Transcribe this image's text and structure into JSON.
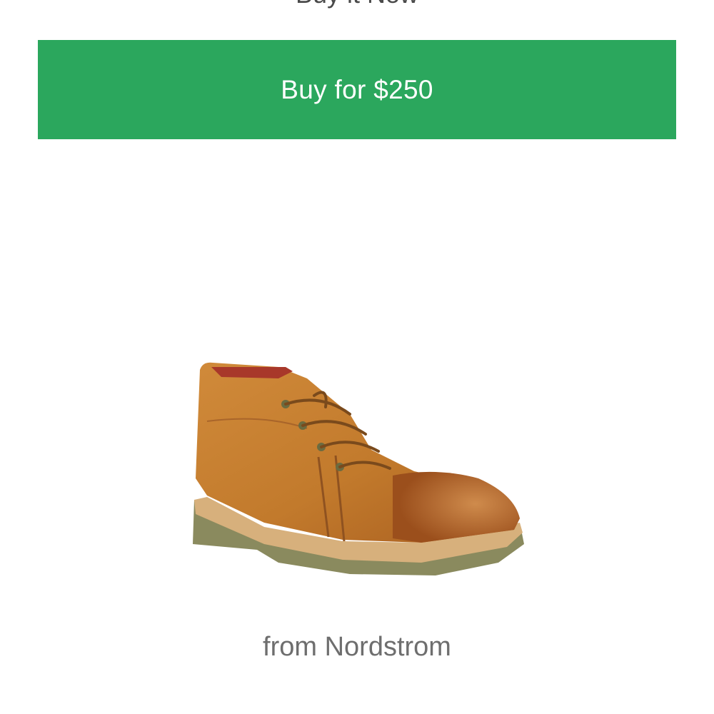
{
  "header": {
    "title_partial": "Buy it Now"
  },
  "buy_button": {
    "label": "Buy for $250",
    "color": "#2ba75d"
  },
  "product": {
    "image_icon": "brown-leather-chukka-boot-icon"
  },
  "retailer": {
    "label": "from Nordstrom"
  }
}
